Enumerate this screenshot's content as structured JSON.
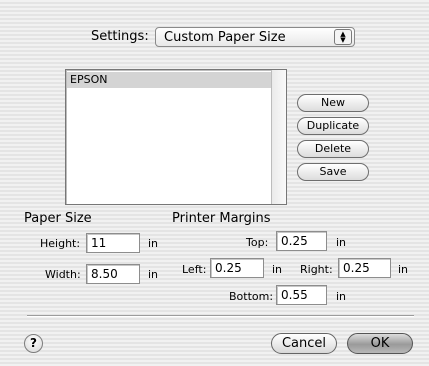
{
  "settings": {
    "label": "Settings:",
    "value": "Custom Paper Size"
  },
  "paper_list": {
    "items": [
      "EPSON"
    ],
    "selected": "EPSON"
  },
  "buttons": {
    "new": "New",
    "duplicate": "Duplicate",
    "delete": "Delete",
    "save": "Save",
    "cancel": "Cancel",
    "ok": "OK",
    "help": "?"
  },
  "paper_size": {
    "heading": "Paper Size",
    "height_label": "Height:",
    "height_value": "11",
    "height_unit": "in",
    "width_label": "Width:",
    "width_value": "8.50",
    "width_unit": "in"
  },
  "margins": {
    "heading": "Printer Margins",
    "top_label": "Top:",
    "top_value": "0.25",
    "top_unit": "in",
    "left_label": "Left:",
    "left_value": "0.25",
    "left_unit": "in",
    "right_label": "Right:",
    "right_value": "0.25",
    "right_unit": "in",
    "bottom_label": "Bottom:",
    "bottom_value": "0.55",
    "bottom_unit": "in"
  }
}
